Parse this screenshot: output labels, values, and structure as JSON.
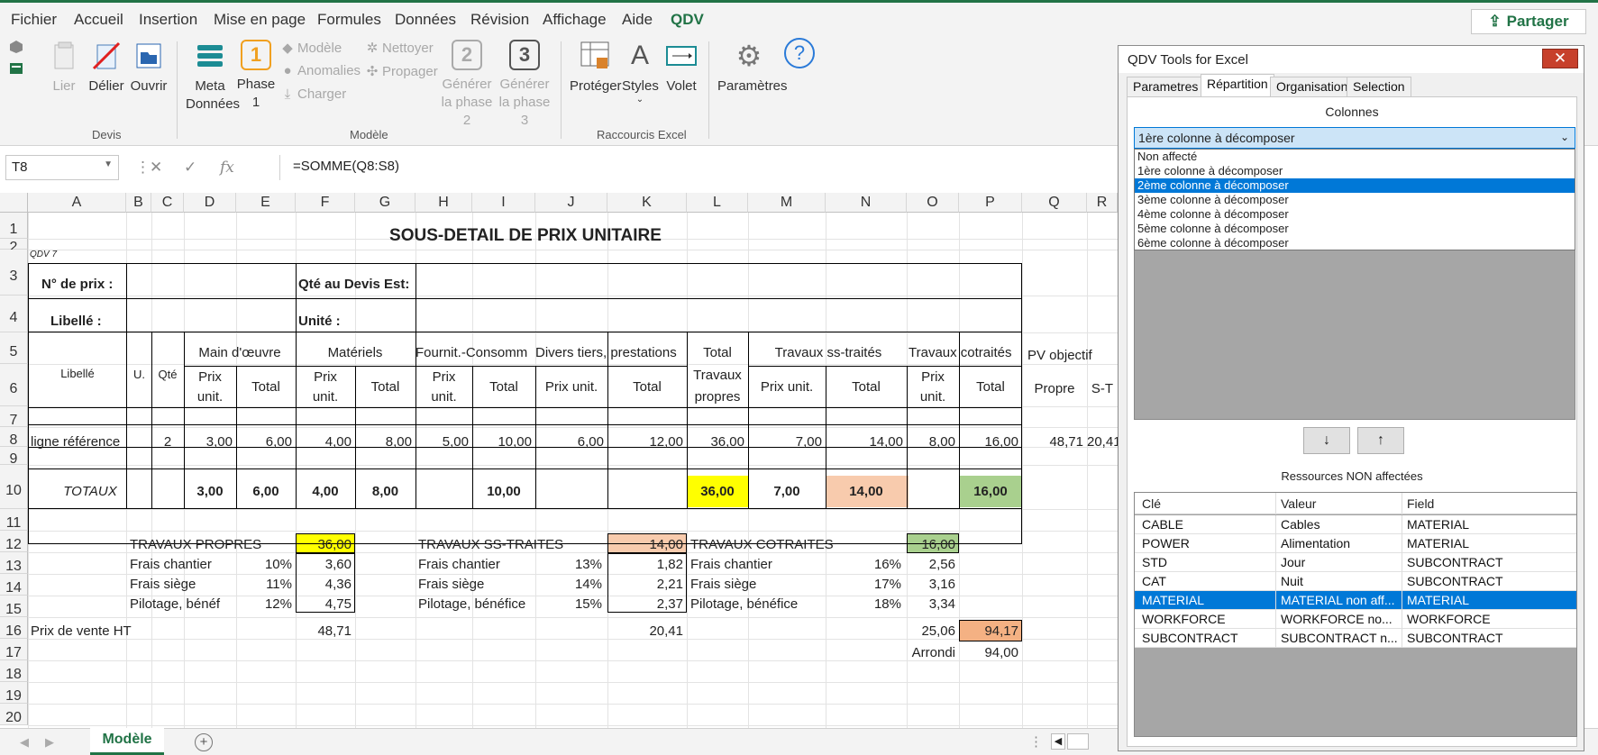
{
  "ribbon_tabs": [
    "Fichier",
    "Accueil",
    "Insertion",
    "Mise en page",
    "Formules",
    "Données",
    "Révision",
    "Affichage",
    "Aide",
    "QDV"
  ],
  "share_label": "Partager",
  "ribbon": {
    "lier": "Lier",
    "delier": "Délier",
    "ouvrir": "Ouvrir",
    "devis_group": "Devis",
    "meta": "Meta",
    "donnees": "Données",
    "phase": "Phase",
    "phase_num": "1",
    "modele": "Modèle",
    "anomalies": "Anomalies",
    "charger": "Charger",
    "nettoyer": "Nettoyer",
    "propager": "Propager",
    "generer": "Générer",
    "la_phase2": "la phase 2",
    "phase2_num": "2",
    "la_phase3": "la phase 3",
    "phase3_num": "3",
    "modele_group": "Modèle",
    "proteger": "Protéger",
    "styles": "Styles",
    "volet": "Volet",
    "raccourcis_group": "Raccourcis Excel",
    "parametres": "Paramètres"
  },
  "formula_bar": {
    "cell_ref": "T8",
    "formula": "=SOMME(Q8:S8)"
  },
  "columns": [
    "A",
    "B",
    "C",
    "D",
    "E",
    "F",
    "G",
    "H",
    "I",
    "J",
    "K",
    "L",
    "M",
    "N",
    "O",
    "P",
    "Q",
    "R"
  ],
  "rows": [
    "1",
    "2",
    "3",
    "4",
    "5",
    "6",
    "7",
    "8",
    "9",
    "10",
    "11",
    "12",
    "13",
    "14",
    "15",
    "16",
    "17",
    "18",
    "19",
    "20"
  ],
  "sheet": {
    "title": "SOUS-DETAIL DE PRIX UNITAIRE",
    "qdv": "QDV 7",
    "n_prix": "N° de prix :",
    "qte_devis": "Qté au Devis Est:",
    "libelle_lbl": "Libellé :",
    "unite_lbl": "Unité :",
    "h_libelle": "Libellé",
    "h_u": "U.",
    "h_qte": "Qté",
    "h_mo": "Main d'œuvre",
    "h_mat": "Matériels",
    "h_fourn": "Fournit.-Consomm",
    "h_divers": "Divers tiers, prestations",
    "h_total": "Total",
    "h_travaux_propres": "Travaux",
    "h_propres": "propres",
    "h_ss": "Travaux ss-traités",
    "h_cotr": "Travaux cotraités",
    "h_pv": "PV objectif",
    "h_propre": "Propre",
    "h_st": "S-T",
    "h_prix": "Prix",
    "h_unit": "unit.",
    "h_prix_unit": "Prix unit.",
    "h_tot": "Total",
    "row8": {
      "label": "ligne référence",
      "qte": "2",
      "d": "3,00",
      "e": "6,00",
      "f": "4,00",
      "g": "8,00",
      "h": "5,00",
      "i": "10,00",
      "j": "6,00",
      "k": "12,00",
      "l": "36,00",
      "m": "7,00",
      "n": "14,00",
      "o": "8,00",
      "p": "16,00",
      "q": "48,71",
      "r": "20,41"
    },
    "totaux": {
      "label": "TOTAUX",
      "d": "3,00",
      "e": "6,00",
      "f": "4,00",
      "g": "8,00",
      "i": "10,00",
      "l": "36,00",
      "m": "7,00",
      "n": "14,00",
      "p": "16,00"
    },
    "tp": {
      "label": "TRAVAUX PROPRES",
      "val": "36,00",
      "fc": "Frais chantier",
      "fc_pct": "10%",
      "fc_val": "3,60",
      "fs": "Frais siège",
      "fs_pct": "11%",
      "fs_val": "4,36",
      "pb": "Pilotage, bénéf",
      "pb_pct": "12%",
      "pb_val": "4,75",
      "pv": "48,71"
    },
    "st": {
      "label": "TRAVAUX SS-TRAITES",
      "val": "14,00",
      "fc": "Frais chantier",
      "fc_pct": "13%",
      "fc_val": "1,82",
      "fs": "Frais siège",
      "fs_pct": "14%",
      "fs_val": "2,21",
      "pb": "Pilotage, bénéfice",
      "pb_pct": "15%",
      "pb_val": "2,37",
      "pv": "20,41"
    },
    "ct": {
      "label": "TRAVAUX COTRAITES",
      "val": "16,00",
      "fc": "Frais chantier",
      "fc_pct": "16%",
      "fc_val": "2,56",
      "fs": "Frais siège",
      "fs_pct": "17%",
      "fs_val": "3,16",
      "pb": "Pilotage, bénéfice",
      "pb_pct": "18%",
      "pb_val": "3,34",
      "pv": "25,06"
    },
    "prix_vente": "Prix de vente HT",
    "total_pv": "94,17",
    "arrondi": "Arrondi",
    "arrondi_val": "94,00"
  },
  "sheet_tab": "Modèle",
  "pane": {
    "title": "QDV Tools for Excel",
    "tabs": [
      "Parametres",
      "Répartition",
      "Organisation",
      "Selection"
    ],
    "active_tab": "Répartition",
    "colonnes_label": "Colonnes",
    "combo_value": "1ère colonne à décomposer",
    "dropdown_options": [
      "Non affecté",
      "1ère colonne à décomposer",
      "2ème colonne à décomposer",
      "3ème colonne à décomposer",
      "4ème colonne à décomposer",
      "5ème colonne à décomposer",
      "6ème colonne à décomposer"
    ],
    "selected_option": "2ème colonne à décomposer",
    "down_arrow": "↓",
    "up_arrow": "↑",
    "ressources_label": "Ressources NON affectées",
    "table_headers": [
      "Clé",
      "Valeur",
      "Field"
    ],
    "table_rows": [
      [
        "CABLE",
        "Cables",
        "MATERIAL"
      ],
      [
        "POWER",
        "Alimentation",
        "MATERIAL"
      ],
      [
        "STD",
        "Jour",
        "SUBCONTRACT"
      ],
      [
        "CAT",
        "Nuit",
        "SUBCONTRACT"
      ],
      [
        "MATERIAL",
        "MATERIAL non aff...",
        "MATERIAL"
      ],
      [
        "WORKFORCE",
        "WORKFORCE no...",
        "WORKFORCE"
      ],
      [
        "SUBCONTRACT",
        "SUBCONTRACT n...",
        "SUBCONTRACT"
      ]
    ],
    "selected_row": "MATERIAL"
  },
  "colors": {
    "accent": "#217346",
    "yellow": "#ffff00",
    "salmon": "#f8cbad",
    "green": "#a9d08e",
    "orange": "#f4b183",
    "select_blue": "#0078d7"
  }
}
